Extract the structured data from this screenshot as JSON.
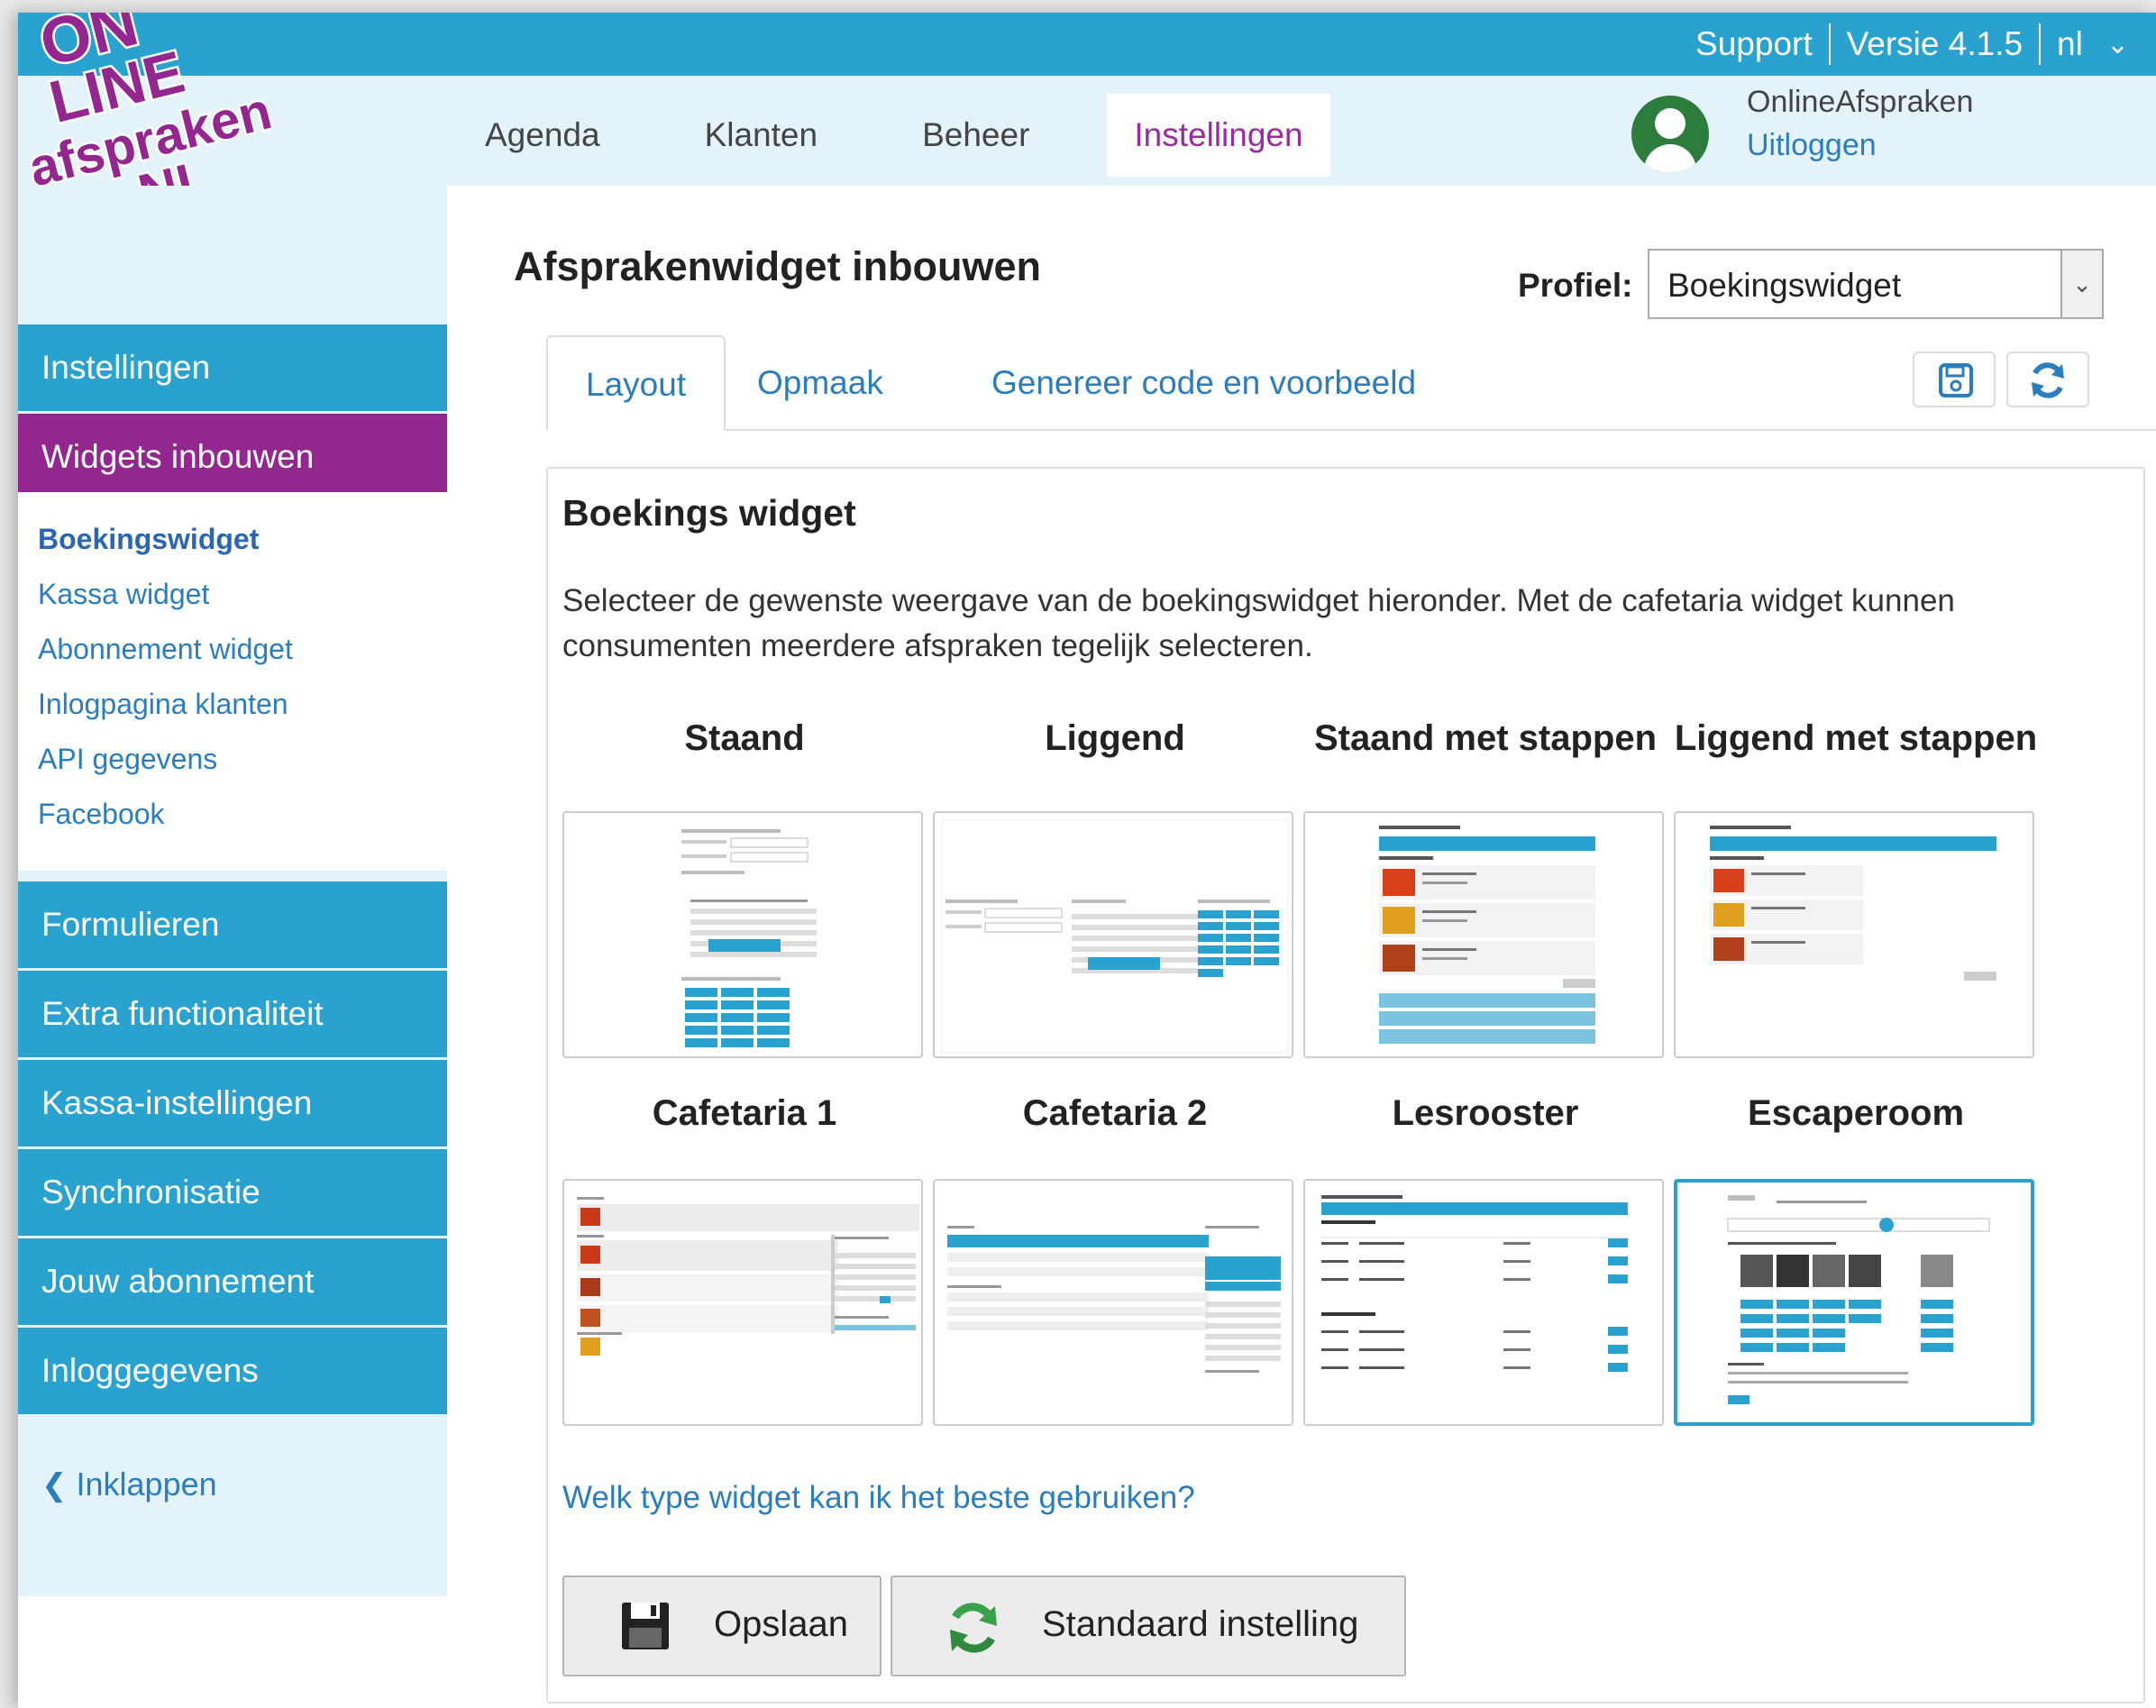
{
  "topbar": {
    "support": "Support",
    "version": "Versie 4.1.5",
    "language": "nl"
  },
  "logo": {
    "line1": "ON",
    "line2": "LINE",
    "line3": "afspraken",
    "line4": ".NL",
    "color": "#93278f"
  },
  "nav": {
    "items": [
      "Agenda",
      "Klanten",
      "Beheer",
      "Instellingen"
    ],
    "active": "Instellingen"
  },
  "user": {
    "name": "OnlineAfspraken",
    "logout": "Uitloggen"
  },
  "sidebar": {
    "top_items": [
      "Instellingen",
      "Widgets inbouwen"
    ],
    "subitems": [
      "Boekingswidget",
      "Kassa widget",
      "Abonnement widget",
      "Inlogpagina klanten",
      "API gegevens",
      "Facebook"
    ],
    "bottom_items": [
      "Formulieren",
      "Extra functionaliteit",
      "Kassa-instellingen",
      "Synchronisatie",
      "Jouw abonnement",
      "Inloggegevens"
    ],
    "collapse": "Inklappen"
  },
  "page": {
    "title": "Afsprakenwidget inbouwen",
    "profile_label": "Profiel:",
    "profile_value": "Boekingswidget"
  },
  "tabs": [
    "Layout",
    "Opmaak",
    "Genereer code en voorbeeld"
  ],
  "panel": {
    "title": "Boekings widget",
    "description": "Selecteer de gewenste weergave van de boekingswidget hieronder. Met de cafetaria widget kunnen consumenten meerdere afspraken tegelijk selecteren.",
    "options": [
      "Staand",
      "Liggend",
      "Staand met stappen",
      "Liggend met stappen",
      "Cafetaria 1",
      "Cafetaria 2",
      "Lesrooster",
      "Escaperoom"
    ],
    "selected": "Escaperoom",
    "help_link": "Welk type widget kan ik het beste gebruiken?",
    "save_label": "Opslaan",
    "default_label": "Standaard instelling"
  },
  "colors": {
    "brand_blue": "#2aa2cf",
    "brand_purple": "#93278f",
    "link_blue": "#2a7dbf"
  }
}
